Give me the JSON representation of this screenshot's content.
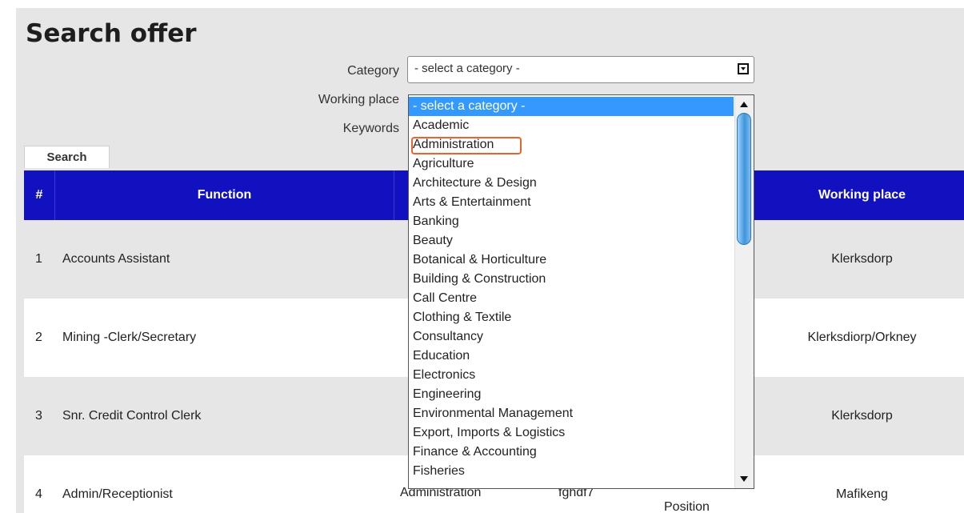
{
  "page": {
    "title": "Search offer"
  },
  "form": {
    "category_label": "Category",
    "working_place_label": "Working place",
    "keywords_label": "Keywords",
    "category_value": "- select a category -",
    "search_button": "Search"
  },
  "table": {
    "headers": [
      "#",
      "Function",
      "Working place"
    ],
    "rows": [
      {
        "num": "1",
        "function": "Accounts Assistant",
        "working_place": "Klerksdorp"
      },
      {
        "num": "2",
        "function": "Mining -Clerk/Secretary",
        "working_place": "Klerksdiorp/Orkney"
      },
      {
        "num": "3",
        "function": "Snr. Credit Control Clerk",
        "working_place": "Klerksdorp"
      },
      {
        "num": "4",
        "function": "Admin/Receptionist",
        "working_place": "Mafikeng",
        "category": "Administration",
        "code": "fghdf7",
        "type": "Position"
      }
    ]
  },
  "dropdown": {
    "options": [
      "- select a category -",
      "Academic",
      "Administration",
      "Agriculture",
      "Architecture & Design",
      "Arts & Entertainment",
      "Banking",
      "Beauty",
      "Botanical & Horticulture",
      "Building & Construction",
      "Call Centre",
      "Clothing & Textile",
      "Consultancy",
      "Education",
      "Electronics",
      "Engineering",
      "Environmental Management",
      "Export, Imports & Logistics",
      "Finance & Accounting",
      "Fisheries"
    ],
    "selected_index": 0,
    "highlighted_option": "Administration"
  },
  "colors": {
    "header_bg": "#1111c0",
    "selected_option_bg": "#3399ff",
    "highlight_box": "#e8632d"
  }
}
